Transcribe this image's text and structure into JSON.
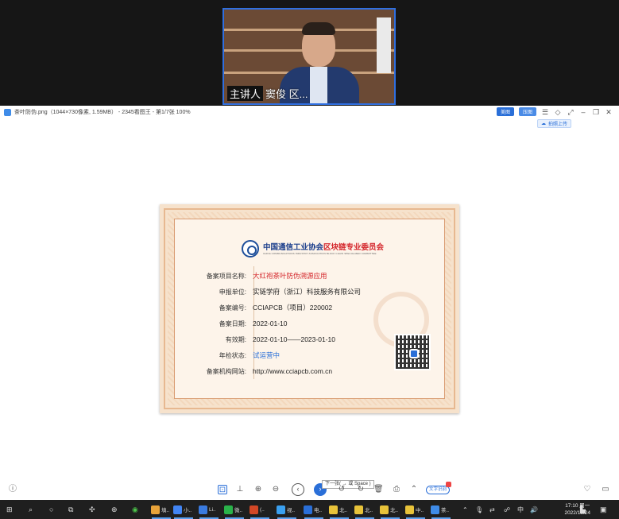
{
  "video": {
    "speaker_role": "主讲人",
    "speaker_name": "窦俊 区..."
  },
  "viewer": {
    "title": "茶叶防伪.png（1044×730像素, 1.59MB） - 2345看图王 - 第1/7张 100%",
    "pill_beautify": "美图",
    "pill_compress": "压图",
    "cloud_upload": "拍照上传"
  },
  "certificate": {
    "org_name_prefix": "中国通信工业协会",
    "org_name_highlight": "区块链专业委员会",
    "org_name_en": "CHINA COMMUNICATIONS INDUSTRY ASSOCIATION BLOCK CHAIN SPECIALIZED COMMITTEE",
    "rows": [
      {
        "label": "备案项目名称:",
        "value": "大红袍茶叶防伪溯源应用",
        "style": "red"
      },
      {
        "label": "申报单位:",
        "value": "实链学府（浙江）科技服务有限公司",
        "style": ""
      },
      {
        "label": "备案编号:",
        "value": "CCIAPCB（项目）220002",
        "style": ""
      },
      {
        "label": "备案日期:",
        "value": "2022-01-10",
        "style": ""
      },
      {
        "label": "有效期:",
        "value": "2022-01-10——2023-01-10",
        "style": ""
      },
      {
        "label": "年检状态:",
        "value": "试运营中",
        "style": "blue"
      },
      {
        "label": "备案机构网站:",
        "value": "http://www.cciapcb.com.cn",
        "style": ""
      }
    ]
  },
  "toolbar": {
    "tooltip": "下一张( → 或 Space )",
    "ocr": "文字识别"
  },
  "taskbar": {
    "items": [
      {
        "label": "填..",
        "color": "#e8a33a"
      },
      {
        "label": "小..",
        "color": "#4285f4"
      },
      {
        "label": "Li..",
        "color": "#3a7be0"
      },
      {
        "label": "微..",
        "color": "#2ab24a"
      },
      {
        "label": "(..",
        "color": "#d24726"
      },
      {
        "label": "视..",
        "color": "#3aa0f0"
      },
      {
        "label": "电..",
        "color": "#2a6fd8"
      },
      {
        "label": "北..",
        "color": "#e8c33a"
      },
      {
        "label": "北..",
        "color": "#e8c33a"
      },
      {
        "label": "北..",
        "color": "#e8c33a"
      },
      {
        "label": "中..",
        "color": "#e8c33a"
      },
      {
        "label": "茶..",
        "color": "#3f8ce8"
      }
    ],
    "time": "17:10 周一",
    "date": "2022/10/24"
  }
}
